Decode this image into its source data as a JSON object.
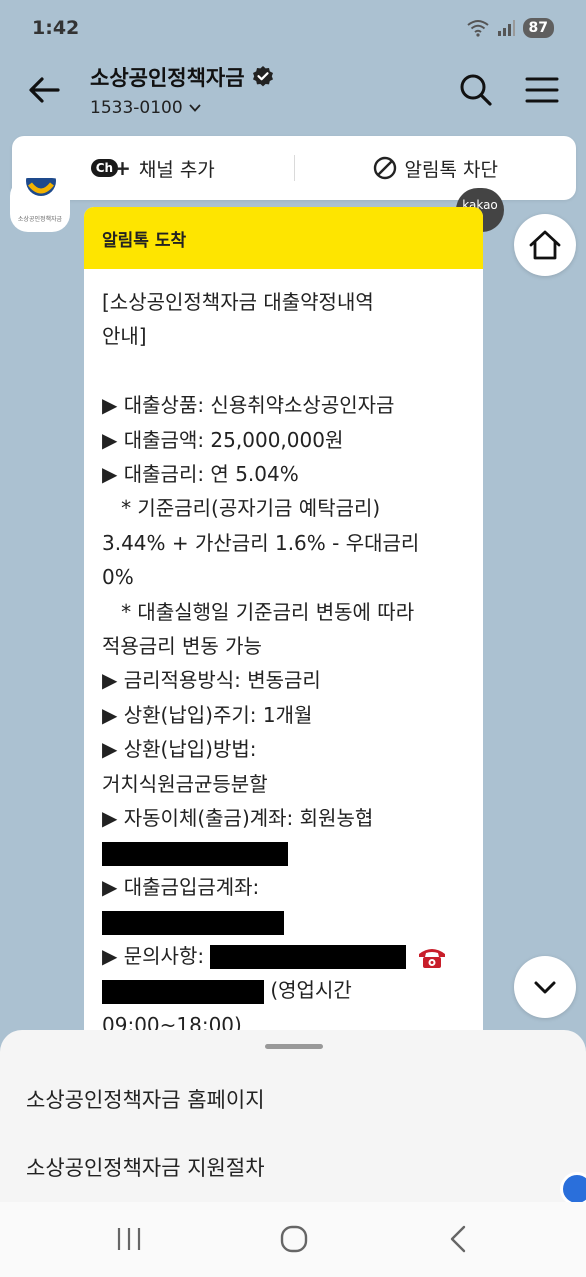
{
  "status": {
    "time": "1:42",
    "battery": "87"
  },
  "header": {
    "title": "소상공인정책자금",
    "phone": "1533-0100"
  },
  "actions": {
    "add_channel": "채널 추가",
    "block": "알림톡 차단"
  },
  "profile": {
    "caption": "소상공인정책자금"
  },
  "kakao_badge": "kakao",
  "message": {
    "header": "알림톡 도착",
    "lines": {
      "l1": "[소상공인정책자금 대출약정내역",
      "l2": "안내]",
      "l3": "▶ 대출상품: 신용취약소상공인자금",
      "l4": "▶ 대출금액: 25,000,000원",
      "l5": "▶ 대출금리: 연 5.04%",
      "l6": "   * 기준금리(공자기금 예탁금리)",
      "l7": "3.44% + 가산금리 1.6% - 우대금리",
      "l8": "0%",
      "l9": "   * 대출실행일 기준금리 변동에 따라",
      "l10": "적용금리 변동 가능",
      "l11": "▶ 금리적용방식: 변동금리",
      "l12": "▶ 상환(납입)주기: 1개월",
      "l13": "▶ 상환(납입)방법:",
      "l14": "거치식원금균등분할",
      "l15": "▶ 자동이체(출금)계좌: 회원농협",
      "l17": "▶ 대출금입금계좌:",
      "l19": "▶ 문의사항:",
      "l20": "(영업시간",
      "l21": "09:00~18:00)"
    }
  },
  "sheet": {
    "item1": "소상공인정책자금 홈페이지",
    "item2": "소상공인정책자금 지원절차"
  },
  "colors": {
    "chat_bg": "#abc1d1",
    "kakao_yellow": "#fee500",
    "sheet_bg": "#f5f5f5"
  },
  "icons": {
    "back": "arrow-left-icon",
    "verified": "verified-badge-icon",
    "search": "search-icon",
    "menu": "hamburger-menu-icon",
    "channel": "channel-add-icon",
    "block": "block-icon",
    "home": "home-icon",
    "down": "chevron-down-icon",
    "phone": "telephone-icon"
  }
}
